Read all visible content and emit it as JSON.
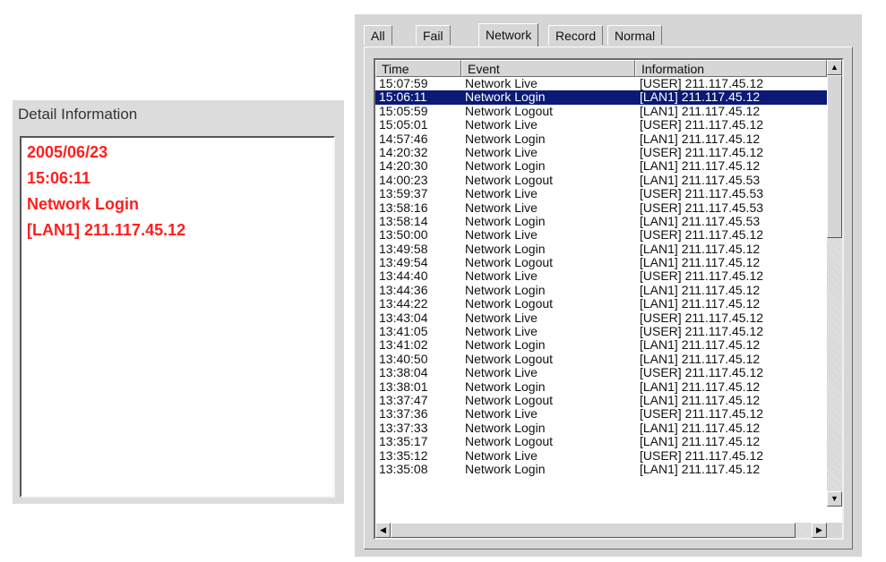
{
  "detail": {
    "title": "Detail Information",
    "lines": [
      "2005/06/23",
      "15:06:11",
      "Network Login",
      "[LAN1] 211.117.45.12"
    ]
  },
  "tabs": [
    {
      "label": "All",
      "selected": false
    },
    {
      "label": "Fail",
      "selected": false
    },
    {
      "label": "Network",
      "selected": true
    },
    {
      "label": "Record",
      "selected": false
    },
    {
      "label": "Normal",
      "selected": false
    }
  ],
  "columns": {
    "time": "Time",
    "event": "Event",
    "info": "Information"
  },
  "rows": [
    {
      "time": "15:07:59",
      "event": "Network Live",
      "info": "[USER] 211.117.45.12"
    },
    {
      "time": "15:06:11",
      "event": "Network Login",
      "info": "[LAN1] 211.117.45.12",
      "selected": true
    },
    {
      "time": "15:05:59",
      "event": "Network Logout",
      "info": "[LAN1] 211.117.45.12"
    },
    {
      "time": "15:05:01",
      "event": "Network Live",
      "info": "[USER] 211.117.45.12"
    },
    {
      "time": "14:57:46",
      "event": "Network Login",
      "info": "[LAN1] 211.117.45.12"
    },
    {
      "time": "14:20:32",
      "event": "Network Live",
      "info": "[USER] 211.117.45.12"
    },
    {
      "time": "14:20:30",
      "event": "Network Login",
      "info": "[LAN1] 211.117.45.12"
    },
    {
      "time": "14:00:23",
      "event": "Network Logout",
      "info": "[LAN1] 211.117.45.53"
    },
    {
      "time": "13:59:37",
      "event": "Network Live",
      "info": "[USER] 211.117.45.53"
    },
    {
      "time": "13:58:16",
      "event": "Network Live",
      "info": "[USER] 211.117.45.53"
    },
    {
      "time": "13:58:14",
      "event": "Network Login",
      "info": "[LAN1] 211.117.45.53"
    },
    {
      "time": "13:50:00",
      "event": "Network Live",
      "info": "[USER] 211.117.45.12"
    },
    {
      "time": "13:49:58",
      "event": "Network Login",
      "info": "[LAN1] 211.117.45.12"
    },
    {
      "time": "13:49:54",
      "event": "Network Logout",
      "info": "[LAN1] 211.117.45.12"
    },
    {
      "time": "13:44:40",
      "event": "Network Live",
      "info": "[USER] 211.117.45.12"
    },
    {
      "time": "13:44:36",
      "event": "Network Login",
      "info": "[LAN1] 211.117.45.12"
    },
    {
      "time": "13:44:22",
      "event": "Network Logout",
      "info": "[LAN1] 211.117.45.12"
    },
    {
      "time": "13:43:04",
      "event": "Network Live",
      "info": "[USER] 211.117.45.12"
    },
    {
      "time": "13:41:05",
      "event": "Network Live",
      "info": "[USER] 211.117.45.12"
    },
    {
      "time": "13:41:02",
      "event": "Network Login",
      "info": "[LAN1] 211.117.45.12"
    },
    {
      "time": "13:40:50",
      "event": "Network Logout",
      "info": "[LAN1] 211.117.45.12"
    },
    {
      "time": "13:38:04",
      "event": "Network Live",
      "info": "[USER] 211.117.45.12"
    },
    {
      "time": "13:38:01",
      "event": "Network Login",
      "info": "[LAN1] 211.117.45.12"
    },
    {
      "time": "13:37:47",
      "event": "Network Logout",
      "info": "[LAN1] 211.117.45.12"
    },
    {
      "time": "13:37:36",
      "event": "Network Live",
      "info": "[USER] 211.117.45.12"
    },
    {
      "time": "13:37:33",
      "event": "Network Login",
      "info": "[LAN1] 211.117.45.12"
    },
    {
      "time": "13:35:17",
      "event": "Network Logout",
      "info": "[LAN1] 211.117.45.12"
    },
    {
      "time": "13:35:12",
      "event": "Network Live",
      "info": "[USER] 211.117.45.12"
    },
    {
      "time": "13:35:08",
      "event": "Network Login",
      "info": "[LAN1] 211.117.45.12"
    }
  ],
  "scrollbar": {
    "up_icon": "scroll-up-arrow-icon",
    "down_icon": "scroll-down-arrow-icon",
    "left_icon": "scroll-left-arrow-icon",
    "right_icon": "scroll-right-arrow-icon"
  },
  "colors": {
    "detail_text": "#ff1e1e",
    "selection_bg": "#0a1a76",
    "panel_bg": "#d6d6d6"
  }
}
